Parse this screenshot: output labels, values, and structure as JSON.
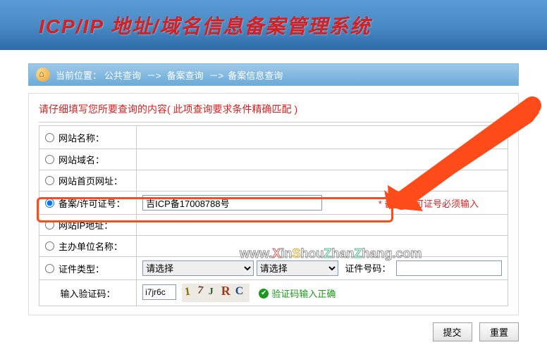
{
  "header": {
    "title": "ICP/IP 地址/域名信息备案管理系统"
  },
  "breadcrumb": {
    "label_current": "当前位置：",
    "item1": "公共查询",
    "sep": "－>",
    "item2": "备案查询",
    "item3": "备案信息查询"
  },
  "section": {
    "title": "请仔细填写您所要查询的内容( 此项查询要求条件精确匹配 )"
  },
  "rows": {
    "site_name": "网站名称：",
    "site_domain": "网站域名：",
    "site_homepage": "网站首页网址：",
    "record_license": "备案/许可证号：",
    "site_ip": "网站IP地址：",
    "sponsor_name": "主办单位名称：",
    "cert_type": "证件类型：",
    "captcha": "输入验证码："
  },
  "values": {
    "record_license_value": "吉ICP备17008788号",
    "captcha_value": "i7jr6c"
  },
  "selects": {
    "placeholder": "请选择",
    "cert_number_label": "证件号码："
  },
  "hints": {
    "record_required": "* 备案/许可证号必须输入",
    "captcha_ok": "验证码输入正确"
  },
  "buttons": {
    "submit": "提交",
    "reset": "重置"
  },
  "watermark": "www.XinShouZhanZhang.com"
}
